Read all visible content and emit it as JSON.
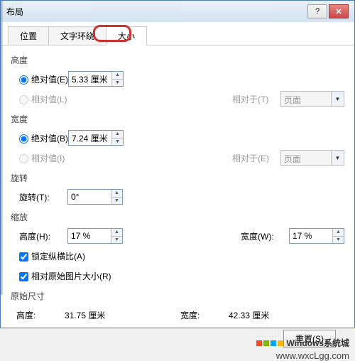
{
  "window": {
    "title": "布局",
    "help_icon": "?",
    "close_icon": "✕"
  },
  "tabs": {
    "position": "位置",
    "text_wrap": "文字环绕",
    "size": "大小"
  },
  "height": {
    "group": "高度",
    "abs_label": "绝对值(E)",
    "abs_value": "5.33 厘米",
    "rel_label": "相对值(L)",
    "rel_to_label": "相对于(T)",
    "rel_to_value": "页面"
  },
  "width": {
    "group": "宽度",
    "abs_label": "绝对值(B)",
    "abs_value": "7.24 厘米",
    "rel_label": "相对值(I)",
    "rel_to_label": "相对于(E)",
    "rel_to_value": "页面"
  },
  "rotation": {
    "group": "旋转",
    "label": "旋转(T):",
    "value": "0°"
  },
  "scale": {
    "group": "缩放",
    "height_label": "高度(H):",
    "height_value": "17 %",
    "width_label": "宽度(W):",
    "width_value": "17 %",
    "lock_aspect": "锁定纵横比(A)",
    "rel_original": "相对原始图片大小(R)"
  },
  "original": {
    "group": "原始尺寸",
    "height_label": "高度:",
    "height_value": "31.75 厘米",
    "width_label": "宽度:",
    "width_value": "42.33 厘米"
  },
  "buttons": {
    "reset": "重置(S)"
  },
  "watermark": {
    "brand": "Windows系统城",
    "url": "www.wxcLgg.com"
  }
}
